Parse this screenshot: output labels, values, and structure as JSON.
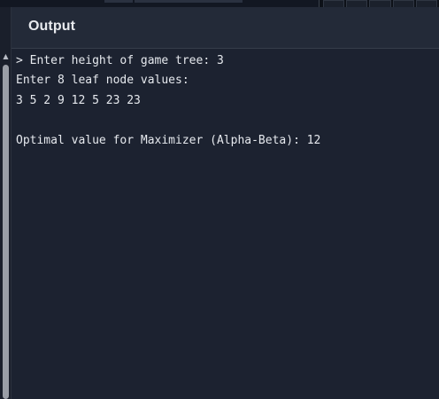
{
  "panel": {
    "title": "Output"
  },
  "console": {
    "lines": [
      "> Enter height of game tree: 3",
      "Enter 8 leaf node values:",
      "3 5 2 9 12 5 23 23",
      "",
      "Optimal value for Maximizer (Alpha-Beta): 12"
    ]
  },
  "scrollbar": {
    "up_icon": "▲"
  }
}
